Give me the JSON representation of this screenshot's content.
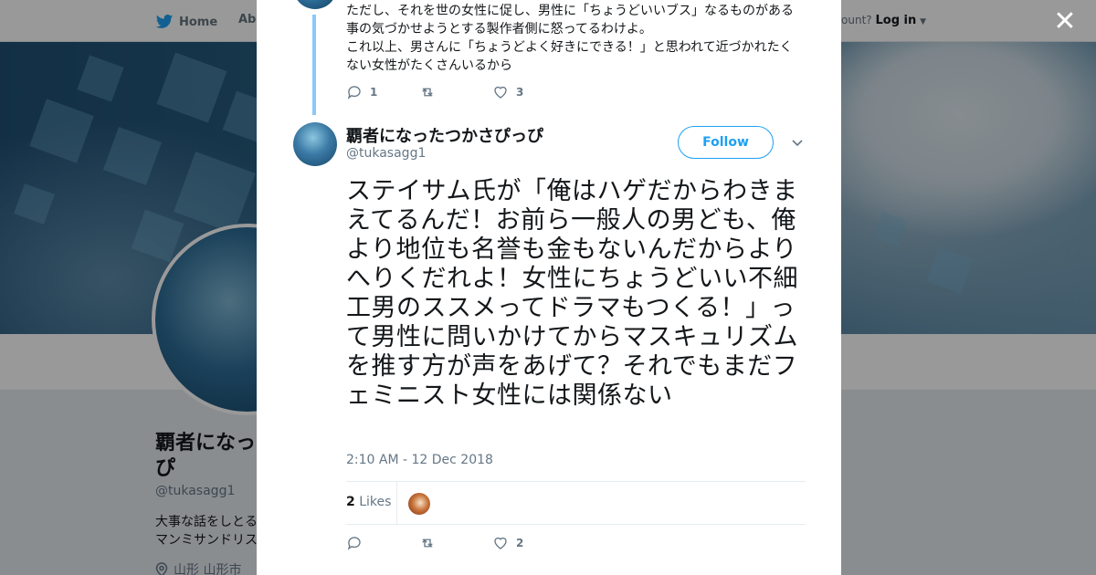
{
  "nav": {
    "home": "Home",
    "about": "Abo",
    "account_prompt": "ccount?",
    "login": "Log in"
  },
  "profile": {
    "name": "覇者になっ",
    "name_line2": "ぴ",
    "handle": "@tukasagg1",
    "bio_line1": "大事な話をしとる",
    "bio_line2": "マンミサンドリス",
    "location": "山形 山形市"
  },
  "prev_tweet": {
    "line1": "ただし、それを世の女性に促し、男性に「ちょうどいいブス」なるものがある",
    "line2": "事の気づかせようとする製作者側に怒ってるわけよ。",
    "line3": "これ以上、男さんに「ちょうどよく好きにできる！」と思われて近づかれたく",
    "line4": "ない女性がたくさんいるから",
    "replies": "1",
    "retweets": "",
    "likes": "3"
  },
  "tweet": {
    "name": "覇者になったつかさぴっぴ",
    "handle": "@tukasagg1",
    "follow_label": "Follow",
    "text": "ステイサム氏が「俺はハゲだからわきまえてるんだ！お前ら一般人の男ども、俺より地位も名誉も金もないんだからよりへりくだれよ！女性にちょうどいい不細工男のススメってドラマもつくる！」って男性に問いかけてからマスキュリズムを推す方が声をあげて？それでもまだフェミニスト女性には関係ない",
    "timestamp": "2:10 AM - 12 Dec 2018",
    "likes_count": "2",
    "likes_label": "Likes",
    "action_replies": "",
    "action_retweets": "",
    "action_likes": "2"
  },
  "colors": {
    "accent": "#1da1f2",
    "thread_line": "#88c9f9",
    "text": "#14171a",
    "muted": "#657786"
  }
}
